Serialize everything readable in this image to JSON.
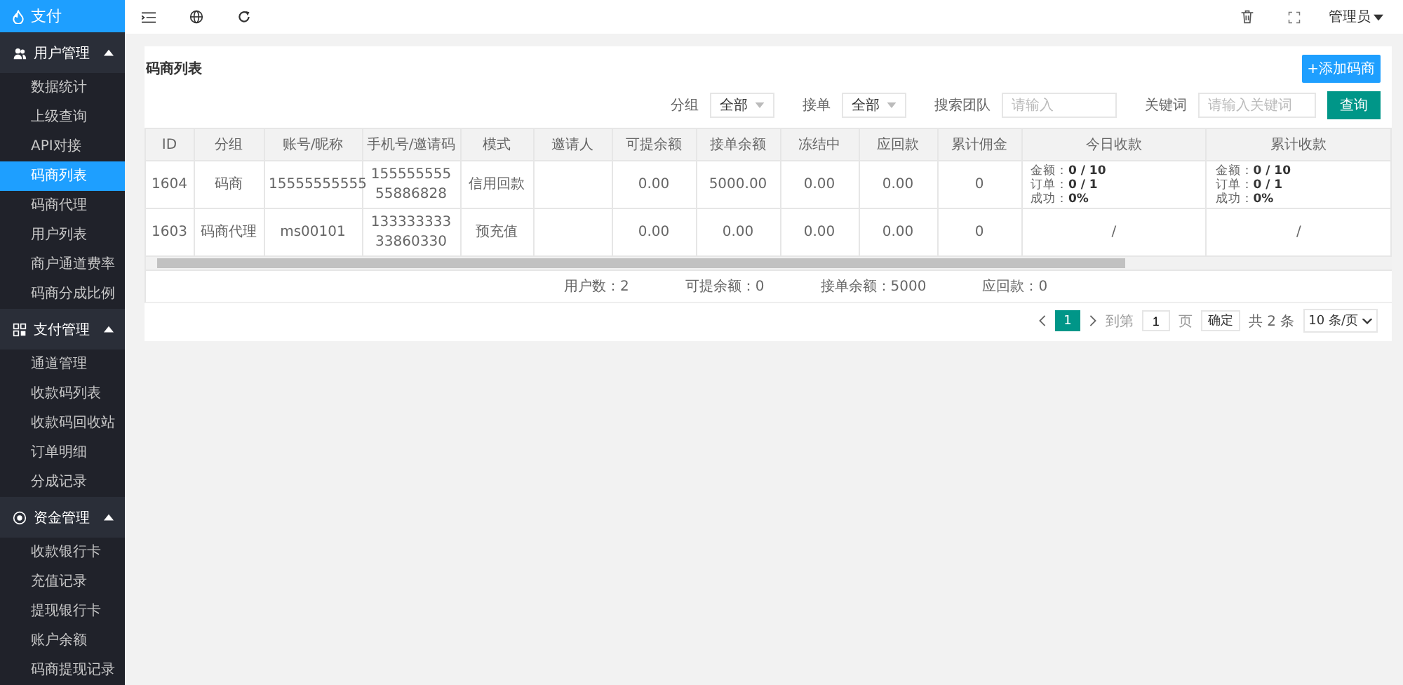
{
  "logo": {
    "title": "支付"
  },
  "sidebar": {
    "groups": [
      {
        "label": "用户管理",
        "expanded": true,
        "items": [
          {
            "label": "数据统计",
            "selected": false
          },
          {
            "label": "上级查询",
            "selected": false
          },
          {
            "label": "API对接",
            "selected": false
          },
          {
            "label": "码商列表",
            "selected": true
          },
          {
            "label": "码商代理",
            "selected": false
          },
          {
            "label": "用户列表",
            "selected": false
          },
          {
            "label": "商户通道费率",
            "selected": false
          },
          {
            "label": "码商分成比例",
            "selected": false
          }
        ]
      },
      {
        "label": "支付管理",
        "expanded": true,
        "items": [
          {
            "label": "通道管理",
            "selected": false
          },
          {
            "label": "收款码列表",
            "selected": false
          },
          {
            "label": "收款码回收站",
            "selected": false
          },
          {
            "label": "订单明细",
            "selected": false
          },
          {
            "label": "分成记录",
            "selected": false
          }
        ]
      },
      {
        "label": "资金管理",
        "expanded": true,
        "items": [
          {
            "label": "收款银行卡",
            "selected": false
          },
          {
            "label": "充值记录",
            "selected": false
          },
          {
            "label": "提现银行卡",
            "selected": false
          },
          {
            "label": "账户余额",
            "selected": false
          },
          {
            "label": "码商提现记录",
            "selected": false
          }
        ]
      }
    ]
  },
  "topbar": {
    "user": "管理员"
  },
  "card": {
    "title": "码商列表",
    "add_button": "+添加码商",
    "filters": [
      {
        "kind": "select",
        "label": "分组",
        "value": "全部"
      },
      {
        "kind": "select",
        "label": "接单",
        "value": "全部"
      },
      {
        "kind": "input",
        "label": "搜索团队",
        "placeholder": "请输入"
      },
      {
        "kind": "input",
        "label": "关键词",
        "placeholder": "请输入关键词"
      }
    ],
    "search_button": "查询"
  },
  "table": {
    "columns": [
      "ID",
      "分组",
      "账号/昵称",
      "手机号/邀请码",
      "模式",
      "邀请人",
      "可提余额",
      "接单余额",
      "冻结中",
      "应回款",
      "累计佣金",
      "今日收款",
      "累计收款"
    ],
    "rows": [
      {
        "cells": [
          "1604",
          "码商",
          "15555555555",
          "15555555555886828",
          "信用回款",
          "",
          "0.00",
          "5000.00",
          "0.00",
          "0.00",
          "0"
        ],
        "today": [
          "金额：**0 / 10**",
          "订单：**0 / 1**",
          "成功：**0%**"
        ],
        "total": [
          "金额：**0 / 10**",
          "订单：**0 / 1**",
          "成功：**0%**"
        ]
      },
      {
        "cells": [
          "1603",
          "码商代理",
          "ms00101",
          "13333333333860330",
          "预充值",
          "",
          "0.00",
          "0.00",
          "0.00",
          "0.00",
          "0"
        ],
        "today": [
          "/"
        ],
        "total": [
          "/"
        ]
      }
    ]
  },
  "summary": [
    "用户数：2",
    "可提余额：0",
    "接单余额：5000",
    "应回款：0"
  ],
  "pagination": {
    "pages": [
      {
        "label": "1",
        "selected": true
      }
    ],
    "goto_label": "到第",
    "goto_value": "1",
    "page_unit": "页",
    "confirm": "确定",
    "total": "共 2 条",
    "page_size": "10 条/页"
  }
}
